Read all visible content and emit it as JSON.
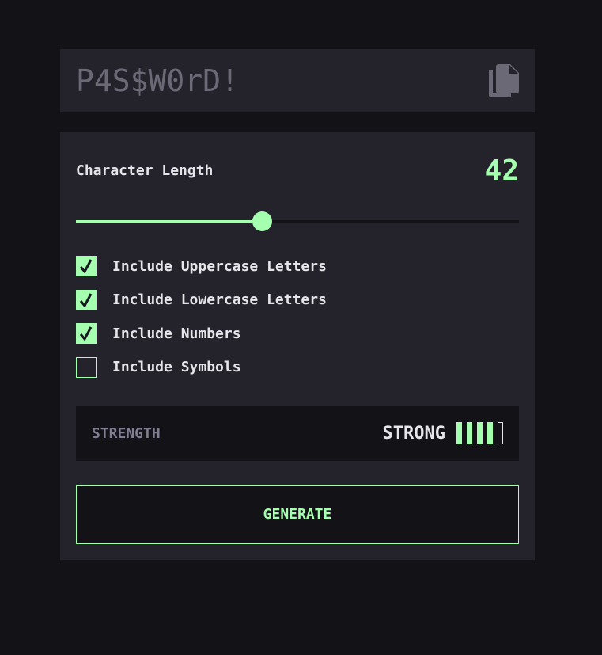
{
  "password": {
    "value": "P4S$W0rD!",
    "copy_icon": "copy-icon"
  },
  "length": {
    "label": "Character Length",
    "value": "42",
    "slider_fraction": 0.42
  },
  "options": [
    {
      "label": "Include Uppercase Letters",
      "checked": true
    },
    {
      "label": "Include Lowercase Letters",
      "checked": true
    },
    {
      "label": "Include Numbers",
      "checked": true
    },
    {
      "label": "Include Symbols",
      "checked": false
    }
  ],
  "strength": {
    "label": "STRENGTH",
    "value": "STRONG",
    "level": 4,
    "max_level": 5
  },
  "generate": {
    "label": "GENERATE"
  },
  "colors": {
    "background": "#131217",
    "panel": "#24232b",
    "accent": "#a4ffaf",
    "text": "#e6e5ea",
    "muted": "#817d92"
  }
}
